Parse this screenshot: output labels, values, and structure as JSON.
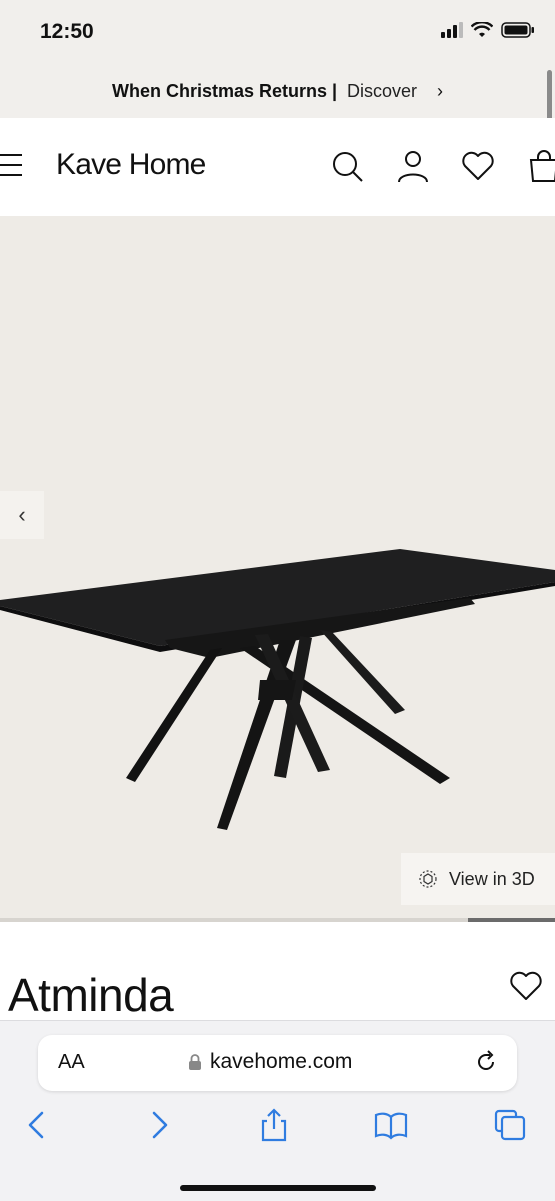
{
  "status_bar": {
    "time": "12:50"
  },
  "announcement": {
    "bold_text": "When Christmas Returns |",
    "link_text": "Discover",
    "chevron": "›"
  },
  "header": {
    "logo": "Kave Home",
    "icons": [
      "hamburger-menu-icon",
      "search-icon",
      "account-icon",
      "heart-icon",
      "shopping-bag-icon"
    ]
  },
  "gallery": {
    "prev_label": "‹",
    "view3d_label": "View in 3D",
    "current_index": 9,
    "total": 9
  },
  "product": {
    "name": "Atminda"
  },
  "browser": {
    "aa_label": "AA",
    "url": "kavehome.com",
    "toolbar_icons": [
      "back-icon",
      "forward-icon",
      "share-icon",
      "bookmarks-icon",
      "tabs-icon"
    ]
  },
  "colors": {
    "announcement_bg": "#f1efec",
    "hero_bg": "#eeebe6",
    "link_blue": "#2f7ce0"
  }
}
